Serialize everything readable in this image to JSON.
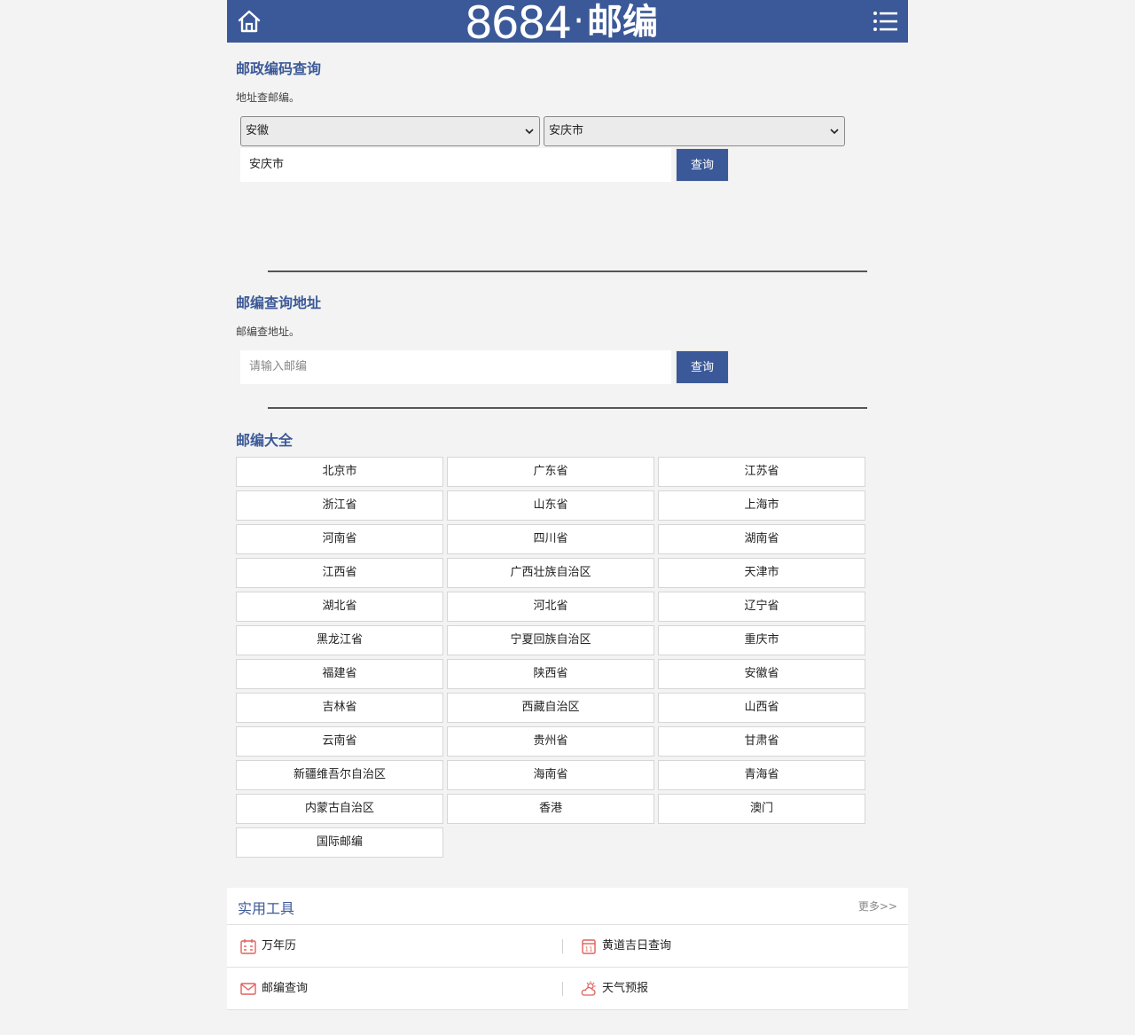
{
  "header": {
    "logo_number": "8684",
    "logo_dot": "·",
    "logo_text": "邮编",
    "home_icon": "home-icon",
    "menu_icon": "menu-icon"
  },
  "postcode_search": {
    "title": "邮政编码查询",
    "desc": "地址查邮编。",
    "province_select": "安徽",
    "city_select": "安庆市",
    "input_value": "安庆市",
    "button": "查询"
  },
  "address_search": {
    "title": "邮编查询地址",
    "desc": "邮编查地址。",
    "input_placeholder": "请输入邮编",
    "button": "查询"
  },
  "directory": {
    "title": "邮编大全",
    "items": [
      "北京市",
      "广东省",
      "江苏省",
      "浙江省",
      "山东省",
      "上海市",
      "河南省",
      "四川省",
      "湖南省",
      "江西省",
      "广西壮族自治区",
      "天津市",
      "湖北省",
      "河北省",
      "辽宁省",
      "黑龙江省",
      "宁夏回族自治区",
      "重庆市",
      "福建省",
      "陕西省",
      "安徽省",
      "吉林省",
      "西藏自治区",
      "山西省",
      "云南省",
      "贵州省",
      "甘肃省",
      "新疆维吾尔自治区",
      "海南省",
      "青海省",
      "内蒙古自治区",
      "香港",
      "澳门",
      "国际邮编"
    ]
  },
  "tools": {
    "title": "实用工具",
    "more": "更多>>",
    "items": [
      {
        "label": "万年历",
        "icon": "calendar-icon"
      },
      {
        "label": "黄道吉日查询",
        "icon": "calendar-day-icon"
      },
      {
        "label": "邮编查询",
        "icon": "mail-icon"
      },
      {
        "label": "天气预报",
        "icon": "weather-icon"
      }
    ]
  },
  "colors": {
    "brand": "#3b5998",
    "icon_red": "#e0605b",
    "background": "#f3f3f3"
  }
}
